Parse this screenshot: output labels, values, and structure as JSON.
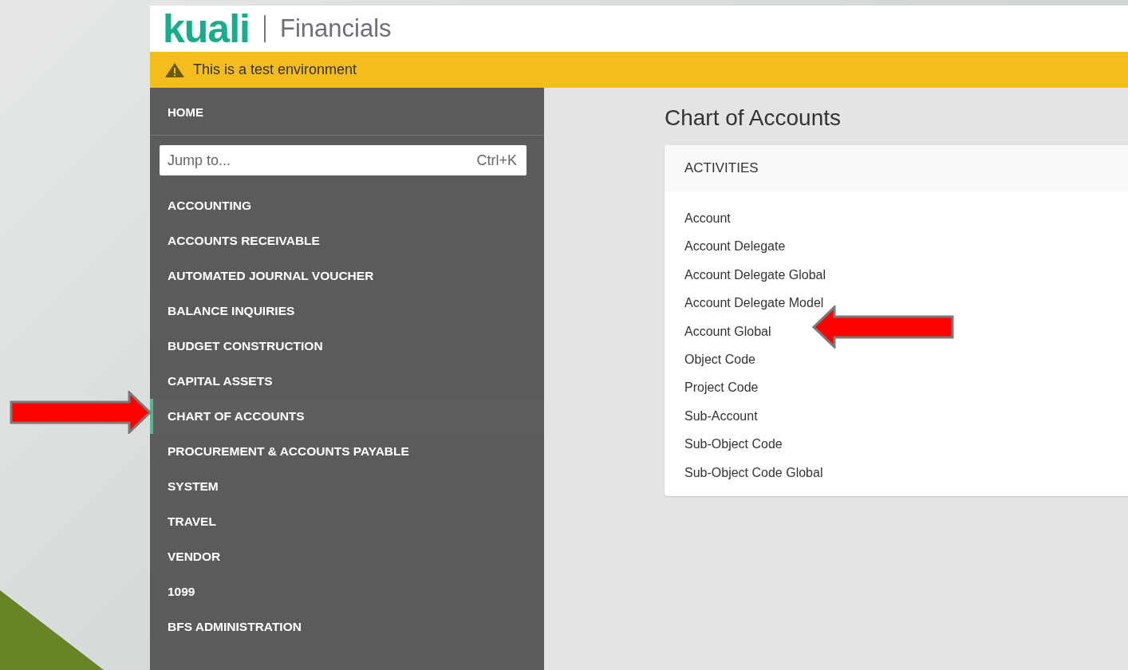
{
  "header": {
    "logo": "kuali",
    "product": "Financials"
  },
  "banner": {
    "text": "This is a test environment"
  },
  "sidebar": {
    "home": "HOME",
    "jump": {
      "placeholder": "Jump to...",
      "shortcut": "Ctrl+K"
    },
    "items": [
      {
        "label": "ACCOUNTING",
        "selected": false
      },
      {
        "label": "ACCOUNTS RECEIVABLE",
        "selected": false
      },
      {
        "label": "AUTOMATED JOURNAL VOUCHER",
        "selected": false
      },
      {
        "label": "BALANCE INQUIRIES",
        "selected": false
      },
      {
        "label": "BUDGET CONSTRUCTION",
        "selected": false
      },
      {
        "label": "CAPITAL ASSETS",
        "selected": false
      },
      {
        "label": "CHART OF ACCOUNTS",
        "selected": true
      },
      {
        "label": "PROCUREMENT & ACCOUNTS PAYABLE",
        "selected": false
      },
      {
        "label": "SYSTEM",
        "selected": false
      },
      {
        "label": "TRAVEL",
        "selected": false
      },
      {
        "label": "VENDOR",
        "selected": false
      },
      {
        "label": "1099",
        "selected": false
      },
      {
        "label": "BFS ADMINISTRATION",
        "selected": false
      }
    ]
  },
  "main": {
    "title": "Chart of Accounts",
    "card": {
      "heading": "ACTIVITIES",
      "links": [
        "Account",
        "Account Delegate",
        "Account Delegate Global",
        "Account Delegate Model",
        "Account Global",
        "Object Code",
        "Project Code",
        "Sub-Account",
        "Sub-Object Code",
        "Sub-Object Code Global"
      ]
    }
  }
}
